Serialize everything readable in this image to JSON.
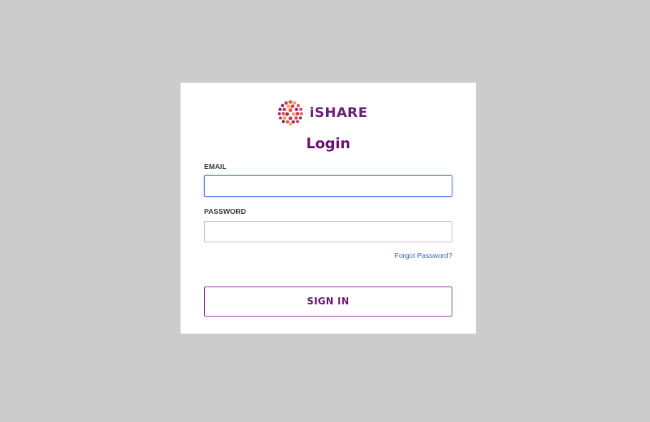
{
  "brand": {
    "name": "iSHARE",
    "icon": "ishare-logo-icon",
    "colors": [
      "#d8345f",
      "#e8583f",
      "#f3a44a",
      "#a0287e",
      "#6b1f7a"
    ]
  },
  "login": {
    "title": "Login",
    "email_label": "EMAIL",
    "email_value": "",
    "password_label": "PASSWORD",
    "password_value": "",
    "forgot_password": "Forgot Password?",
    "sign_in": "SIGN IN"
  },
  "colors": {
    "background": "#cccccc",
    "card": "#ffffff",
    "accent": "#6b1372",
    "link": "#3a66c4",
    "focus": "#5a7ce6"
  }
}
